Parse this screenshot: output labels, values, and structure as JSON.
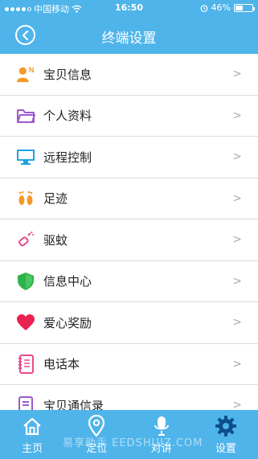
{
  "status_bar": {
    "carrier": "中国移动",
    "time": "16:50",
    "battery": "46%",
    "battery_level": 0.46
  },
  "header": {
    "title": "终端设置"
  },
  "menu": [
    {
      "label": "宝贝信息",
      "icon": "child-info-icon"
    },
    {
      "label": "个人资料",
      "icon": "folder-icon"
    },
    {
      "label": "远程控制",
      "icon": "monitor-icon"
    },
    {
      "label": "足迹",
      "icon": "footprints-icon"
    },
    {
      "label": "驱蚊",
      "icon": "mosquito-repellent-icon"
    },
    {
      "label": "信息中心",
      "icon": "shield-icon"
    },
    {
      "label": "爱心奖励",
      "icon": "heart-icon"
    },
    {
      "label": "电话本",
      "icon": "phonebook-icon"
    },
    {
      "label": "宝贝通信录",
      "icon": "contacts-icon"
    }
  ],
  "chevron": ">",
  "tabs": [
    {
      "label": "主页",
      "icon": "home-icon"
    },
    {
      "label": "定位",
      "icon": "location-pin-icon"
    },
    {
      "label": "对讲",
      "icon": "microphone-icon"
    },
    {
      "label": "设置",
      "icon": "gear-icon"
    }
  ],
  "watermark": "易享助手 EEDSHUIZ.COM",
  "colors": {
    "brand": "#4fb4ea",
    "divider": "#dcdcdc",
    "chevron": "#aaaaaa"
  }
}
